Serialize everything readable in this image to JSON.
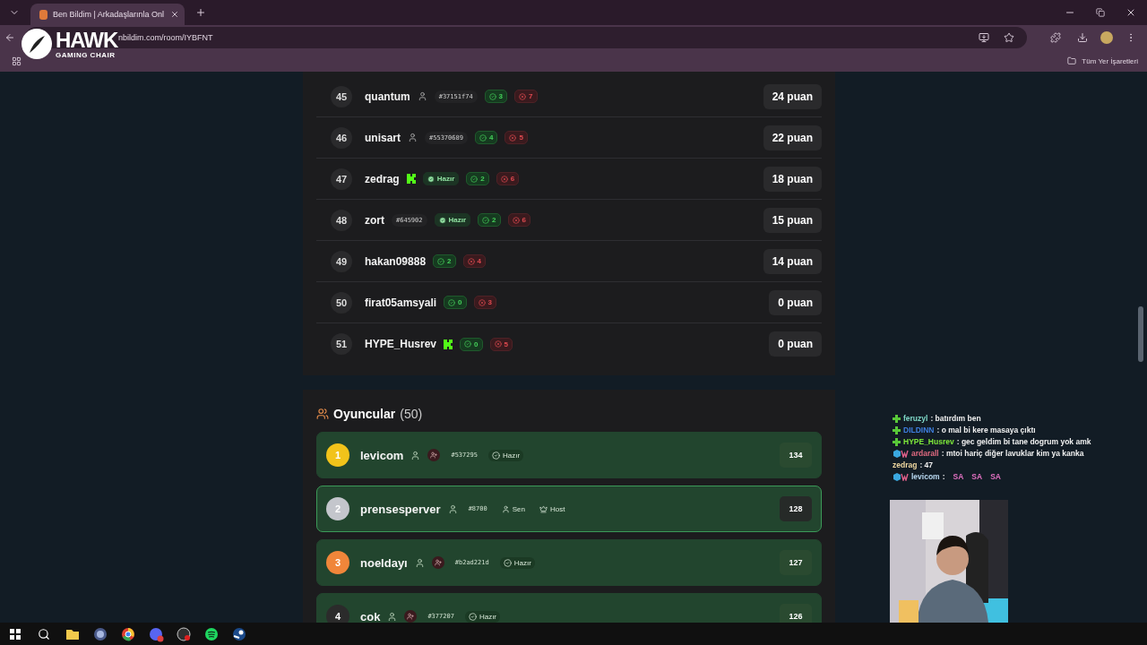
{
  "browser": {
    "tabs": [
      {
        "title": "Ben Bildim | Arkadaşlarınla Onl",
        "selected": true
      }
    ],
    "url": "nbildim.com/room/IYBFNT",
    "bookmarks": "Tüm Yer İşaretleri"
  },
  "overlay_logo": {
    "name": "HAWK",
    "tagline": "GAMING CHAIR"
  },
  "leaderboard": [
    {
      "rank": "45",
      "name": "quantum",
      "kind": "guest",
      "tag": "#37151f74",
      "correct": "3",
      "wrong": "7",
      "score": "24 puan"
    },
    {
      "rank": "46",
      "name": "unisart",
      "kind": "guest",
      "tag": "#55370689",
      "correct": "4",
      "wrong": "5",
      "score": "22 puan"
    },
    {
      "rank": "47",
      "name": "zedrag",
      "kind": "kick",
      "status": "Hazır",
      "correct": "2",
      "wrong": "6",
      "score": "18 puan"
    },
    {
      "rank": "48",
      "name": "zort",
      "kind": "plain",
      "tag": "#645902",
      "status": "Hazır",
      "correct": "2",
      "wrong": "6",
      "score": "15 puan"
    },
    {
      "rank": "49",
      "name": "hakan09888",
      "kind": "plain",
      "correct": "2",
      "wrong": "4",
      "score": "14 puan"
    },
    {
      "rank": "50",
      "name": "firat05amsyali",
      "kind": "plain",
      "correct": "0",
      "wrong": "3",
      "score": "0 puan"
    },
    {
      "rank": "51",
      "name": "HYPE_Husrev",
      "kind": "kick",
      "correct": "0",
      "wrong": "5",
      "score": "0 puan"
    }
  ],
  "players": {
    "title": "Oyuncular",
    "count": "(50)",
    "items": [
      {
        "rank": "1",
        "color": "#f2c31a",
        "name": "levicom",
        "add_friend": true,
        "tag": "#537295",
        "badges": [
          {
            "kind": "ready",
            "label": "Hazır"
          }
        ],
        "score": "134",
        "selected": false
      },
      {
        "rank": "2",
        "color": "#c4c6cc",
        "name": "prensesperver",
        "add_friend": false,
        "tag": "#8700",
        "badges": [
          {
            "kind": "you",
            "label": "Sen"
          },
          {
            "kind": "host",
            "label": "Host"
          }
        ],
        "score": "128",
        "selected": true
      },
      {
        "rank": "3",
        "color": "#f0863a",
        "name": "noeldayı",
        "add_friend": true,
        "tag": "#b2ad221d",
        "badges": [
          {
            "kind": "ready",
            "label": "Hazır"
          }
        ],
        "score": "127",
        "selected": false
      },
      {
        "rank": "4",
        "color": "#2b2b2b",
        "name": "cok",
        "add_friend": true,
        "tag": "#377207",
        "badges": [
          {
            "kind": "ready",
            "label": "Hazır"
          }
        ],
        "score": "126",
        "selected": false
      }
    ]
  },
  "chat": [
    {
      "kind": "plus",
      "name": "feruzyl",
      "color": "#7fd8c8",
      "text": ": batırdım ben"
    },
    {
      "kind": "plus",
      "name": "DILDINN",
      "color": "#3f7fe0",
      "text": ": o mal bi kere masaya çıktı"
    },
    {
      "kind": "plus",
      "name": "HYPE_Husrev",
      "color": "#7ee83a",
      "text": ": gec geldim bi tane dogrum yok amk"
    },
    {
      "kind": "sub",
      "name": "ardarall",
      "color": "#e06a80",
      "text": ": mtoi hariç diğer lavuklar kim ya kanka"
    },
    {
      "kind": "plain",
      "name": "zedrag",
      "color": "#f0d8a0",
      "text": ": 47"
    },
    {
      "kind": "sub",
      "name": "levicom",
      "color": "#b8d8f0",
      "text": ":",
      "emotes": [
        "SA",
        "SA",
        "SA"
      ]
    }
  ]
}
